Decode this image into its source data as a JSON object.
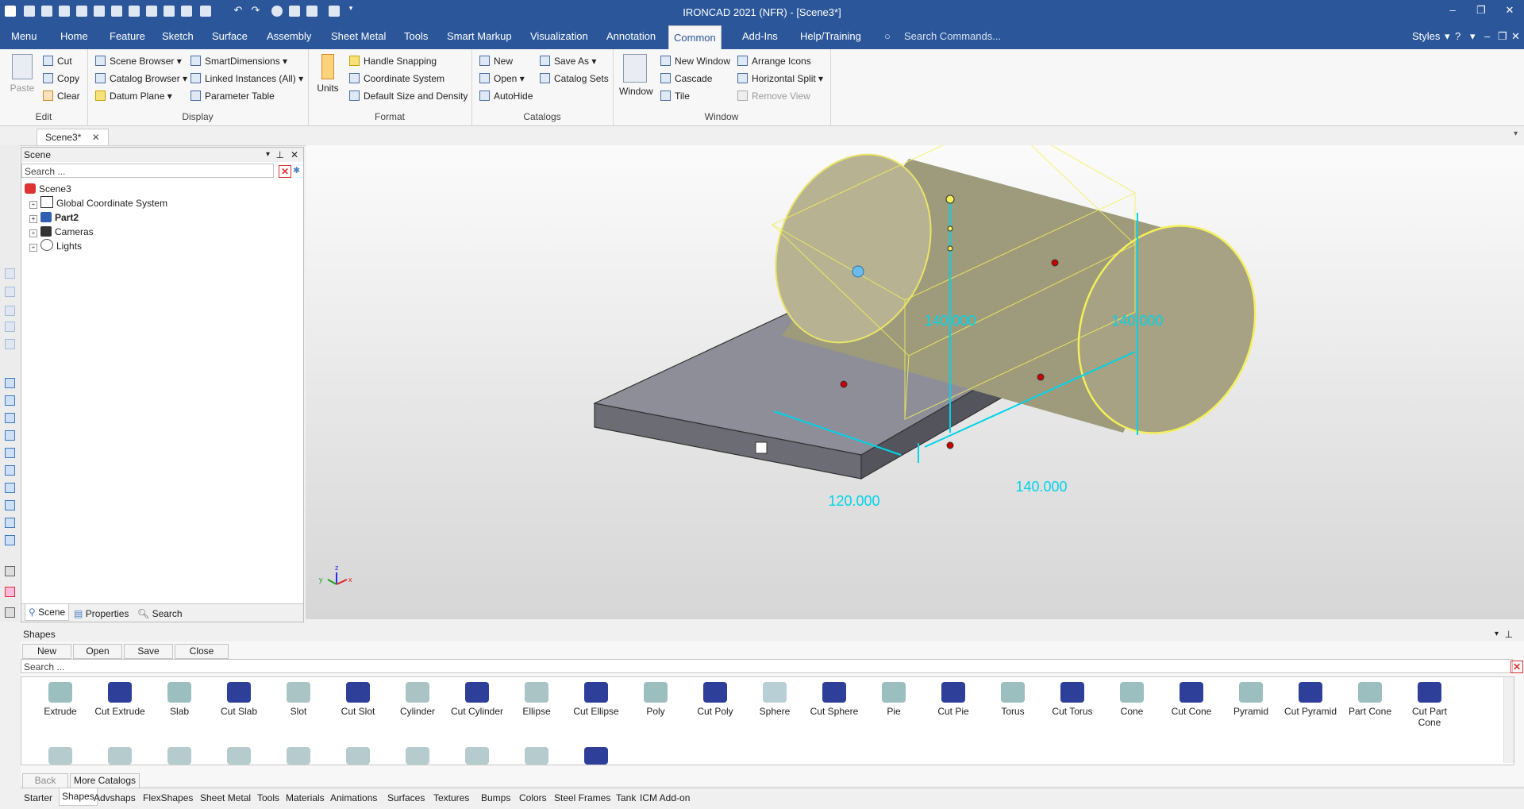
{
  "title_bar": {
    "title": "IRONCAD 2021 (NFR) - [Scene3*]"
  },
  "ribbon_tabs": [
    "Menu",
    "Home",
    "Feature",
    "Sketch",
    "Surface",
    "Assembly",
    "Sheet Metal",
    "Tools",
    "Smart Markup",
    "Visualization",
    "Annotation",
    "Common",
    "Add-Ins",
    "Help/Training"
  ],
  "active_tab": "Common",
  "search_commands_placeholder": "Search Commands...",
  "styles_label": "Styles",
  "groups": {
    "edit": {
      "name": "Edit",
      "paste": "Paste",
      "cut": "Cut",
      "copy": "Copy",
      "clear": "Clear"
    },
    "display": {
      "name": "Display",
      "scene_browser": "Scene Browser",
      "catalog_browser": "Catalog Browser",
      "datum_plane": "Datum Plane",
      "smart_dimensions": "SmartDimensions",
      "linked_instances": "Linked Instances (All)",
      "parameter_table": "Parameter Table"
    },
    "format": {
      "name": "Format",
      "units": "Units",
      "handle_snapping": "Handle Snapping",
      "coordinate_system": "Coordinate System",
      "default_size": "Default Size and Density"
    },
    "catalogs": {
      "name": "Catalogs",
      "new": "New",
      "open": "Open",
      "autohide": "AutoHide",
      "save_as": "Save As",
      "catalog_sets": "Catalog Sets"
    },
    "window": {
      "name": "Window",
      "window": "Window",
      "new_window": "New Window",
      "cascade": "Cascade",
      "tile": "Tile",
      "arrange_icons": "Arrange Icons",
      "horizontal_split": "Horizontal Split",
      "remove_view": "Remove View"
    }
  },
  "doc_tab": "Scene3*",
  "scene_panel": {
    "title": "Scene",
    "search_placeholder": "Search ...",
    "root": "Scene3",
    "items": [
      {
        "label": "Global Coordinate System",
        "bold": false
      },
      {
        "label": "Part2",
        "bold": true
      },
      {
        "label": "Cameras",
        "bold": false
      },
      {
        "label": "Lights",
        "bold": false
      }
    ],
    "bottom_tabs": [
      "Scene",
      "Properties",
      "Search"
    ]
  },
  "viewport": {
    "dimensions": [
      "140.000",
      "140.000",
      "140.000",
      "120.000"
    ],
    "axes": {
      "x": "x",
      "y": "y",
      "z": "z"
    }
  },
  "shapes_panel": {
    "title": "Shapes",
    "buttons": [
      "New",
      "Open",
      "Save",
      "Close"
    ],
    "search_placeholder": "Search ...",
    "row1": [
      "Extrude",
      "Cut Extrude",
      "Slab",
      "Cut Slab",
      "Slot",
      "Cut Slot",
      "Cylinder",
      "Cut Cylinder",
      "Ellipse",
      "Cut Ellipse",
      "Poly",
      "Cut Poly",
      "Sphere",
      "Cut Sphere",
      "Pie",
      "Cut Pie",
      "Torus",
      "Cut Torus",
      "Cone",
      "Cut Cone",
      "Pyramid",
      "Cut Pyramid",
      "Part Cone",
      "Cut Part Cone"
    ],
    "back": "Back",
    "more_catalogs": "More Catalogs"
  },
  "catalog_tabs": [
    "Starter",
    "Shapes",
    "Advshaps",
    "FlexShapes",
    "Sheet Metal",
    "Tools",
    "Materials",
    "Animations",
    "Surfaces",
    "Textures",
    "Bumps",
    "Colors",
    "Steel Frames",
    "Tank",
    "ICM Add-on"
  ],
  "active_catalog": "Shapes",
  "colors": {
    "brand": "#2b579a",
    "dimension": "#00d4e8",
    "highlight": "#f3f05a"
  }
}
